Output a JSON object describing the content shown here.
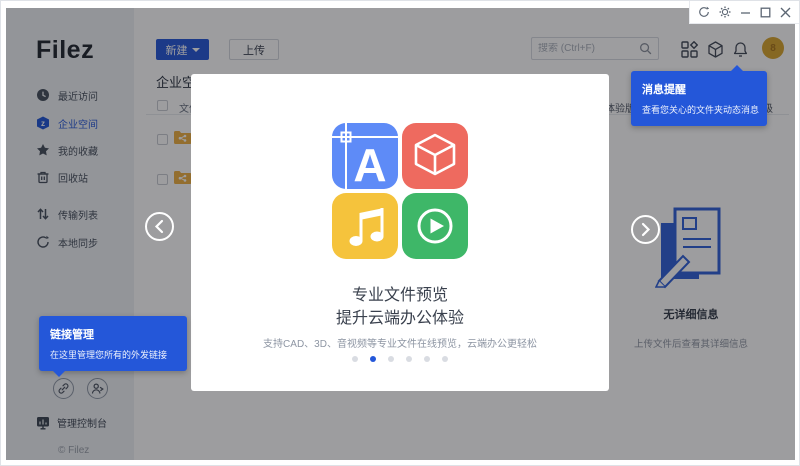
{
  "colors": {
    "accent": "#2457d9",
    "tile_blue": "#5e8bf7",
    "tile_red": "#ee6a5f",
    "tile_yellow": "#f5c33c",
    "tile_green": "#3eb768",
    "folder": "#efb041",
    "avatar": "#d9a62d"
  },
  "window": {
    "controls": [
      "refresh",
      "settings",
      "minimize",
      "maximize",
      "close"
    ]
  },
  "sidebar": {
    "logo": "Filez",
    "items": [
      {
        "label": "最近访问",
        "icon": "clock"
      },
      {
        "label": "企业空间",
        "icon": "enterprise-space",
        "active": true
      },
      {
        "label": "我的收藏",
        "icon": "star"
      },
      {
        "label": "回收站",
        "icon": "trash"
      },
      {
        "label": "传输列表",
        "icon": "transfer"
      },
      {
        "label": "本地同步",
        "icon": "sync"
      }
    ],
    "admin_console": "管理控制台",
    "copyright": "© Filez"
  },
  "header": {
    "new_button": "新建",
    "upload_button": "上传",
    "search_placeholder": "搜索 (Ctrl+F)",
    "avatar_text": "8"
  },
  "banner": {
    "trial_label": "体验版",
    "upgrade_label": "升级"
  },
  "content": {
    "heading": "企业空间",
    "table_header": "文件名",
    "rows": [
      {
        "icon": "shared-folder"
      },
      {
        "icon": "shared-folder"
      }
    ]
  },
  "detail_panel": {
    "title": "无详细信息",
    "subtitle": "上传文件后查看其详细信息"
  },
  "modal": {
    "title_line1": "专业文件预览",
    "title_line2": "提升云端办公体验",
    "subtitle": "支持CAD、3D、音视频等专业文件在线预览，云端办公更轻松",
    "tiles": [
      "cad-preview",
      "3d-cube-preview",
      "audio-preview",
      "video-preview"
    ],
    "cad_letter": "A",
    "dots_total": 6,
    "active_dot": 2
  },
  "tooltips": {
    "message": {
      "title": "消息提醒",
      "body": "查看您关心的文件夹动态消息"
    },
    "link": {
      "title": "链接管理",
      "body": "在这里管理您所有的外发链接"
    }
  }
}
